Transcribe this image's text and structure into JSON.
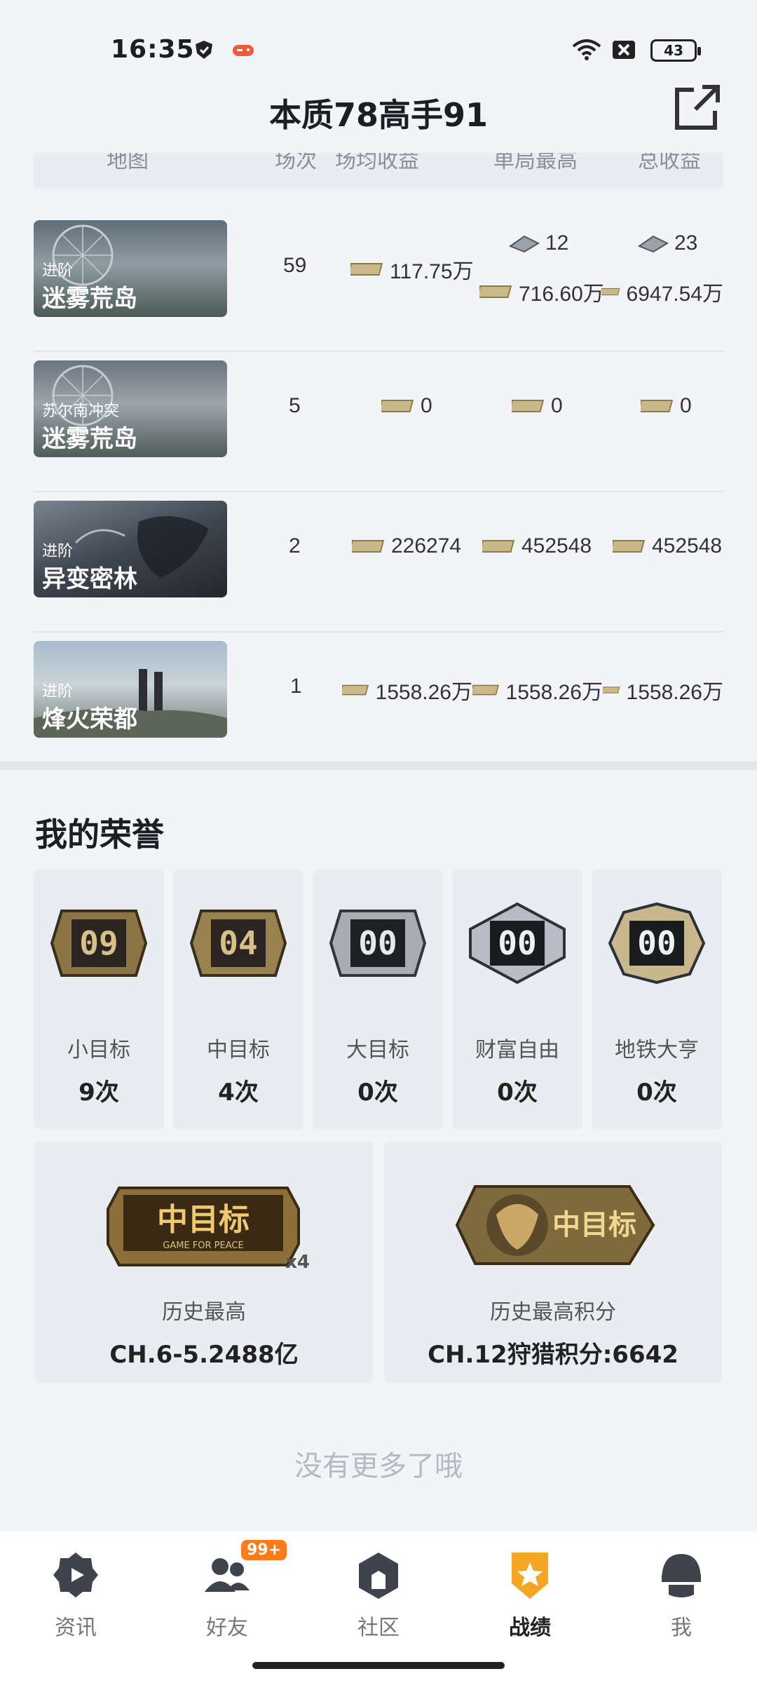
{
  "status_bar": {
    "time": "16:35",
    "battery": "43"
  },
  "header": {
    "title": "本质78高手91"
  },
  "table": {
    "columns": [
      "地图",
      "场次",
      "场均收益",
      "单局最高",
      "总收益"
    ],
    "rows": [
      {
        "tier": "进阶",
        "map": "迷雾荒岛",
        "matches": "59",
        "avg": "117.75万",
        "best_chip": "12",
        "best": "716.60万",
        "total_chip": "23",
        "total": "6947.54万"
      },
      {
        "tier": "苏尔南冲突",
        "map": "迷雾荒岛",
        "matches": "5",
        "avg": "0",
        "best": "0",
        "total": "0"
      },
      {
        "tier": "进阶",
        "map": "异变密林",
        "matches": "2",
        "avg": "226274",
        "best": "452548",
        "total": "452548"
      },
      {
        "tier": "进阶",
        "map": "烽火荣都",
        "matches": "1",
        "avg": "1558.26万",
        "best": "1558.26万",
        "total": "1558.26万"
      }
    ]
  },
  "honors": {
    "title": "我的荣誉",
    "cards": [
      {
        "badge_number": "09",
        "label": "小目标",
        "count": "9次"
      },
      {
        "badge_number": "04",
        "label": "中目标",
        "count": "4次"
      },
      {
        "badge_number": "00",
        "label": "大目标",
        "count": "0次"
      },
      {
        "badge_number": "00",
        "label": "财富自由",
        "count": "0次"
      },
      {
        "badge_number": "00",
        "label": "地铁大亨",
        "count": "0次"
      }
    ],
    "records": [
      {
        "badge_text": "中目标",
        "badge_sub": "GAME FOR PEACE",
        "multiplier": "x4",
        "label": "历史最高",
        "value": "CH.6-5.2488亿"
      },
      {
        "badge_text": "中目标",
        "label": "历史最高积分",
        "value": "CH.12狩猎积分:6642"
      }
    ]
  },
  "footer_text": "没有更多了哦",
  "nav": {
    "items": [
      {
        "label": "资讯",
        "icon": "news-icon"
      },
      {
        "label": "好友",
        "icon": "friends-icon",
        "badge": "99+"
      },
      {
        "label": "社区",
        "icon": "community-icon"
      },
      {
        "label": "战绩",
        "icon": "record-icon",
        "active": true
      },
      {
        "label": "我",
        "icon": "profile-icon"
      }
    ]
  },
  "colors": {
    "accent": "#f5a623",
    "gold": "#b89a5a",
    "background": "#f2f4f8"
  }
}
